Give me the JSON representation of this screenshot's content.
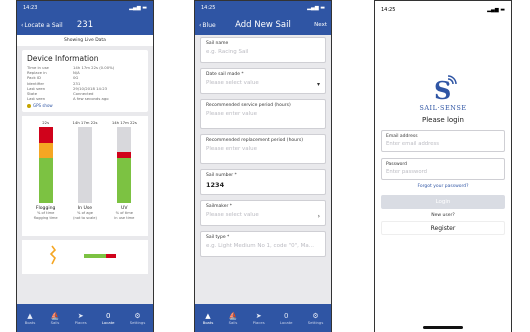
{
  "colors": {
    "brand_blue": "#2f55a4",
    "green": "#7cc242",
    "amber": "#f5a623",
    "red": "#d0021b",
    "track": "#d8d8dc"
  },
  "screen1": {
    "status_time": "14:23",
    "nav_back": "Locate a Sail",
    "nav_title": "231",
    "subtitle": "Showing Live Data",
    "device_info": {
      "title": "Device Information",
      "rows": [
        {
          "k": "Time in use",
          "v": "14h 17m 22s (0.00%)"
        },
        {
          "k": "Replace in",
          "v": "N/A"
        },
        {
          "k": "Pack ID",
          "v": "0G"
        },
        {
          "k": "Identifier",
          "v": "231"
        },
        {
          "k": "Last seen",
          "v": "29/10/2018 14:23"
        },
        {
          "k": "State",
          "v": "Connected"
        },
        {
          "k": "Last seen",
          "v": "A few seconds ago"
        }
      ],
      "gps_link": "GPS show"
    },
    "bars": [
      {
        "top": "22s",
        "name": "Flogging",
        "desc1": "% of time",
        "desc2": "flogging time",
        "green": 0.6,
        "amber": 0.2,
        "red": 0.2
      },
      {
        "top": "14h 17m 22s",
        "name": "In Use",
        "desc1": "% of age",
        "desc2": "(not to scale)",
        "green": 0,
        "amber": 0,
        "red": 0
      },
      {
        "top": "14h 17m 22s",
        "name": "UV",
        "desc1": "% of time",
        "desc2": "in use time",
        "green": 0.6,
        "amber": 0,
        "red": 0.08
      }
    ],
    "tabs": [
      {
        "icon": "▲",
        "label": "Boats",
        "active": false
      },
      {
        "icon": "⛵",
        "label": "Sails",
        "active": false
      },
      {
        "icon": "➤",
        "label": "Places",
        "active": false
      },
      {
        "icon": "0",
        "label": "Locate",
        "active": true
      },
      {
        "icon": "⚙",
        "label": "Settings",
        "active": false
      }
    ]
  },
  "screen2": {
    "status_time": "14:25",
    "nav_back": "Blue",
    "nav_title": "Add New Sail",
    "nav_next": "Next",
    "fields": [
      {
        "label": "Sail name",
        "placeholder": "e.g. Racing Sail",
        "value": "",
        "arrow": ""
      },
      {
        "label": "Date sail made *",
        "placeholder": "Please select value",
        "value": "",
        "arrow": "▾"
      },
      {
        "label": "Recommended service period (hours)",
        "placeholder": "Please enter value",
        "value": "",
        "arrow": ""
      },
      {
        "label": "Recommended replacement period (hours)",
        "placeholder": "Please enter value",
        "value": "",
        "arrow": ""
      },
      {
        "label": "Sail number *",
        "placeholder": "",
        "value": "1234",
        "arrow": ""
      },
      {
        "label": "Sailmaker *",
        "placeholder": "Please select value",
        "value": "",
        "arrow": "›"
      },
      {
        "label": "Sail type *",
        "placeholder": "e.g. Light Medium No 1, code \"0\", Ma...",
        "value": "",
        "arrow": ""
      }
    ],
    "tabs": [
      {
        "icon": "▲",
        "label": "Boats",
        "active": true
      },
      {
        "icon": "⛵",
        "label": "Sails",
        "active": false
      },
      {
        "icon": "➤",
        "label": "Places",
        "active": false
      },
      {
        "icon": "0",
        "label": "Locate",
        "active": false
      },
      {
        "icon": "⚙",
        "label": "Settings",
        "active": false
      }
    ]
  },
  "screen3": {
    "status_time": "14:25",
    "logo_text": "SAIL·SENSE",
    "title": "Please login",
    "email_label": "Email address",
    "email_placeholder": "Enter email address",
    "password_label": "Password",
    "password_placeholder": "Enter password",
    "forgot": "Forgot your password?",
    "login": "Login",
    "new_user": "New user?",
    "register": "Register"
  }
}
